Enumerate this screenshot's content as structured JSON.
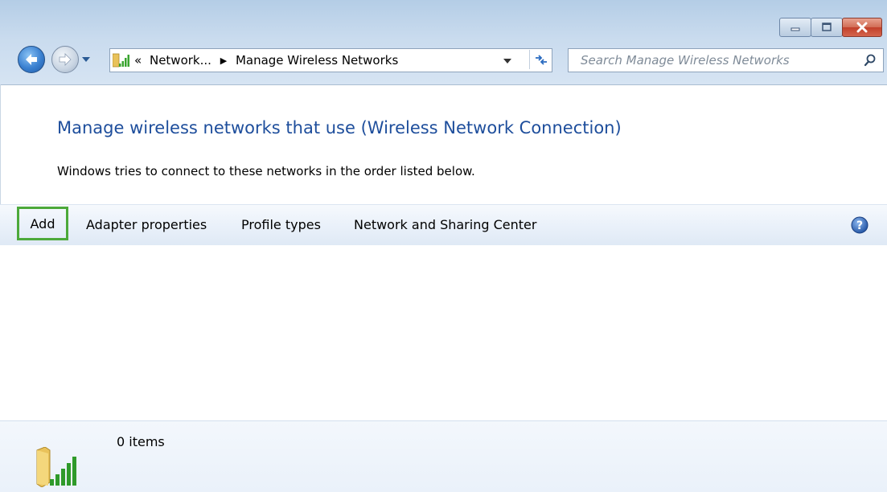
{
  "window": {
    "controls": {
      "minimize": "minimize-icon",
      "maximize": "maximize-icon",
      "close": "close-icon"
    }
  },
  "navigation": {
    "back": "back-arrow-icon",
    "forward": "forward-arrow-icon",
    "recent": "chevron-down-icon"
  },
  "address_bar": {
    "icon": "wireless-signal-icon",
    "overflow": "«",
    "segments": [
      "Network...",
      "Manage Wireless Networks"
    ]
  },
  "search": {
    "placeholder": "Search Manage Wireless Networks",
    "icon": "search-icon"
  },
  "page": {
    "title": "Manage wireless networks that use (Wireless Network Connection)",
    "description": "Windows tries to connect to these networks in the order listed below."
  },
  "toolbar": {
    "add": "Add",
    "adapter_properties": "Adapter properties",
    "profile_types": "Profile types",
    "network_sharing_center": "Network and Sharing Center",
    "help_icon": "help-icon"
  },
  "details": {
    "count": "0 items"
  },
  "colors": {
    "title_blue": "#1e4e9c",
    "highlight_green": "#4ca93a",
    "close_red": "#c2402a"
  }
}
